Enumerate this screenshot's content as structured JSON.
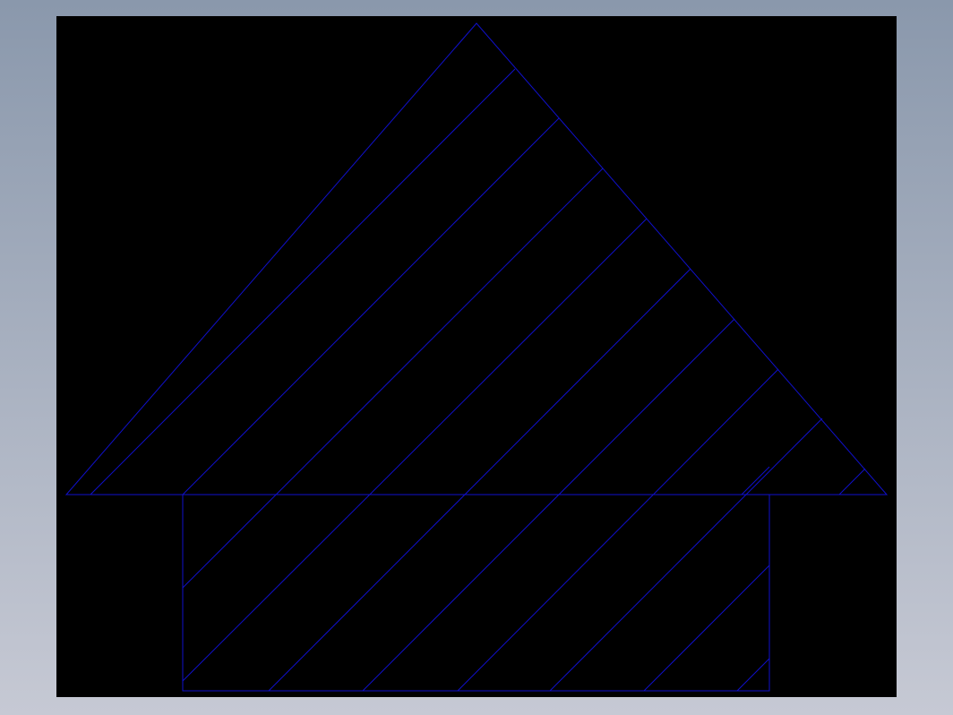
{
  "viewport": {
    "background_top": "#8a98ac",
    "background_bottom": "#c6c9d4"
  },
  "canvas": {
    "background": "#000000"
  },
  "drawing": {
    "line_color": "#1010cc",
    "hatch_color": "#1010cc",
    "description_shapes": [
      "triangle",
      "rectangle",
      "hatch-lines"
    ]
  }
}
